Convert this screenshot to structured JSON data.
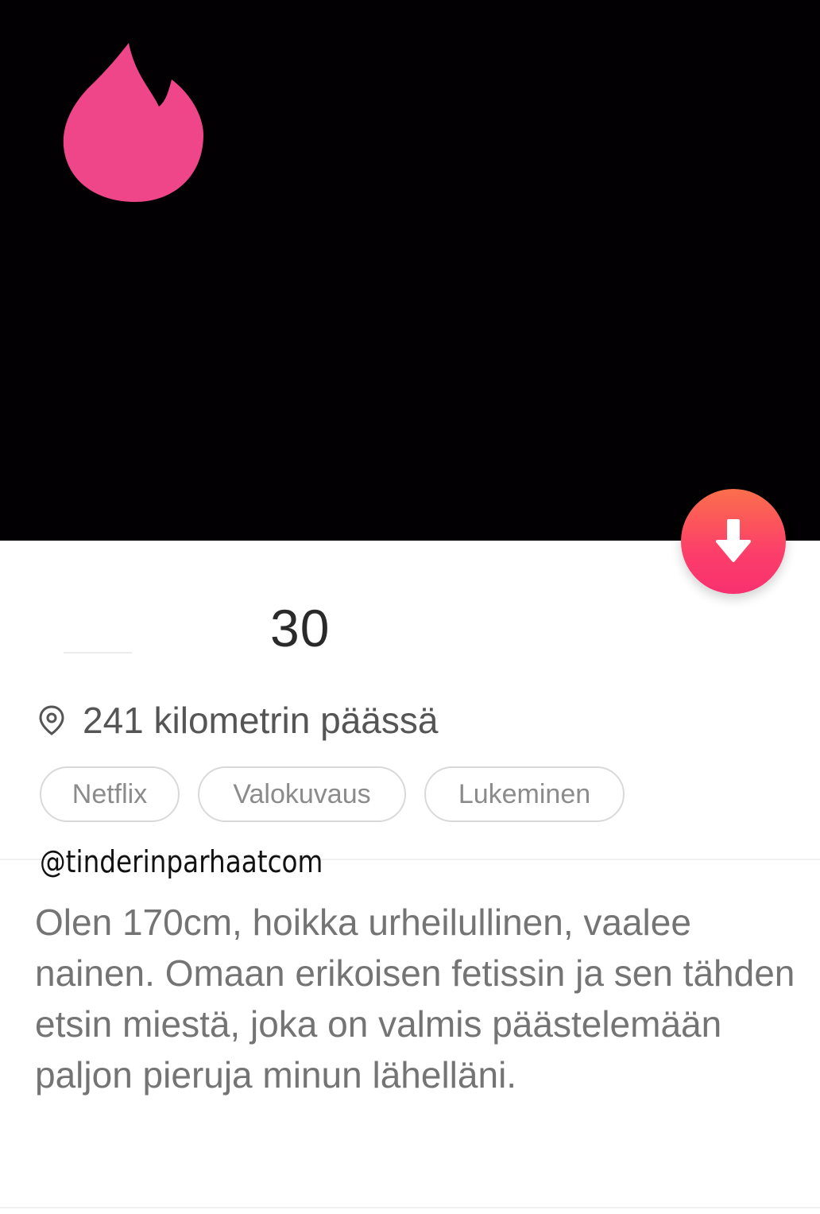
{
  "profile": {
    "age": "30",
    "location": "241 kilometrin päässä",
    "interests": [
      "Netflix",
      "Valokuvaus",
      "Lukeminen"
    ],
    "watermark": "@tinderinparhaatcom",
    "bio": "Olen 170cm, hoikka urheilullinen, vaalee nainen. Omaan erikoisen fetissin ja sen tähden etsin miestä, joka on valmis päästelemään paljon pieruja minun lähelläni."
  },
  "icons": {
    "logo": "tinder-flame-icon",
    "collapse": "arrow-down-icon",
    "location": "location-pin-icon"
  },
  "colors": {
    "brand_pink": "#ee4688",
    "button_top": "#fb6f4c",
    "button_bottom": "#f8306f",
    "photo_bg": "#020002"
  }
}
